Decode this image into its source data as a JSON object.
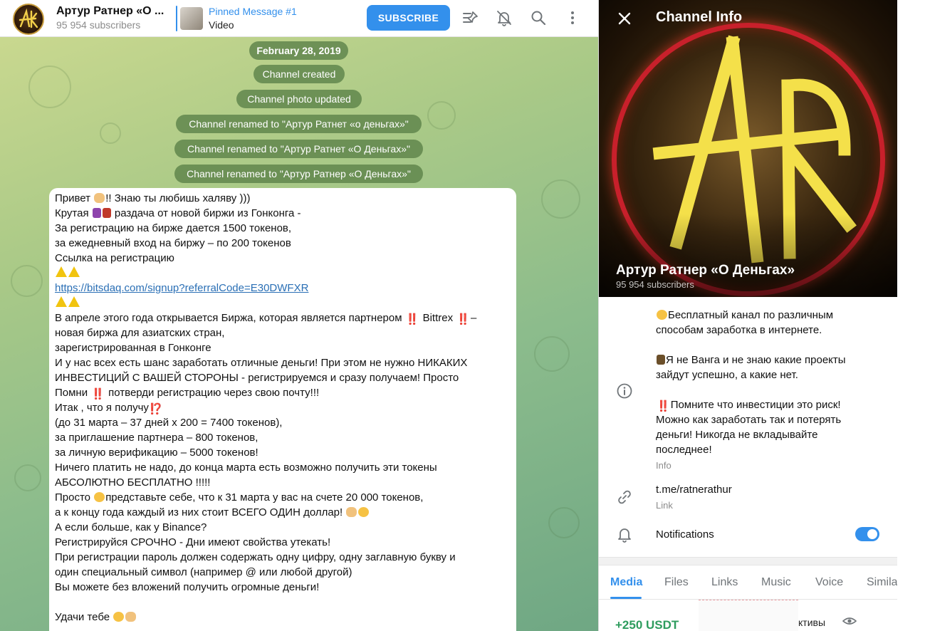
{
  "chat": {
    "title": "Артур Ратнер «О ...",
    "subscribers": "95 954 subscribers",
    "pinned_label": "Pinned Message #1",
    "pinned_text": "Video",
    "subscribe_label": "SUBSCRIBE",
    "icons": [
      "pinned-list-icon",
      "mute-bell-icon",
      "search-icon",
      "more-vertical-icon"
    ]
  },
  "service_messages": [
    "February 28, 2019",
    "Channel created",
    "Channel photo updated",
    "Channel renamed to \"Артур Ратнет «о деньгах»\"",
    "Channel renamed to \"Артур Ратнет «О Деньгах»\"",
    "Channel renamed to \"Артур Ратнер «О Деньгах»\""
  ],
  "message": {
    "l01": "Привет ",
    "l01b": "!! Знаю ты любишь халяву )))",
    "l02": "Крутая ",
    "l02b": " раздача от новой биржи из Гонконга -",
    "l03": "За регистрацию на бирже дается 1500 токенов,",
    "l04": "за ежедневный вход на биржу – по 200 токенов",
    "l05": "Ссылка на регистрацию",
    "link": "https://bitsdaq.com/signup?referralCode=E30DWFXR",
    "l08": "В апреле этого года открывается Биржа, которая является партнером ",
    "l08b": " Bittrex ",
    "l08c": "–",
    "l09": "новая биржа для азиатских стран,",
    "l10": "зарегистрированная в Гонконге",
    "l11": "И у нас всех есть шанс заработать отличные деньги! При этом не нужно НИКАКИХ",
    "l12": "ИНВЕСТИЦИЙ С ВАШЕЙ СТОРОНЫ - регистрируемся и сразу получаем! Просто",
    "l13": "Помни ",
    "l13b": " потверди регистрацию через свою почту!!!",
    "l14": "Итак , что я получу",
    "l15": "(до 31 марта – 37 дней х 200 = 7400 токенов),",
    "l16": "за приглашение партнера – 800 токенов,",
    "l17": "за личную верификацию – 5000 токенов!",
    "l18": "Ничего платить не надо, до конца марта есть возможно получить эти токены",
    "l19": "АБСОЛЮТНО БЕСПЛАТНО !!!!!",
    "l20": "Просто ",
    "l20b": "представьте себе, что к 31 марта у вас на счете 20 000 токенов,",
    "l21": "а к концу года каждый из них стоит ВСЕГО ОДИН доллар! ",
    "l22": "А если больше, как у Binance?",
    "l23": "Регистрируйся СРОЧНО - Дни имеют свойства утекать!",
    "l24": "При регистрации пароль должен содержать одну цифру, одну заглавную букву и",
    "l25": "один специальный символ (например @ или любой другой)",
    "l26": "Вы можете без вложений получить огромные деньги!",
    "l28": "Удачи тебе ",
    "bang": "‼️",
    "interrobang": "⁉️"
  },
  "info": {
    "header": "Channel Info",
    "name": "Артур Ратнер «О Деньгах»",
    "subscribers": "95 954 subscribers",
    "desc1": "Бесплатный канал по различным",
    "desc2": "способам заработка в интернете.",
    "desc3": "Я не Ванга и не знаю какие проекты",
    "desc4": "зайдут успешно, а какие нет.",
    "desc5": "Помните что инвестиции это риск!",
    "desc6": "Можно как заработать так и потерять",
    "desc7": "деньги! Никогда не вкладывайте",
    "desc8": "последнее!",
    "desc_label": "Info",
    "link": "t.me/ratnerathur",
    "link_label": "Link",
    "notifications": "Notifications",
    "notifications_on": true,
    "tabs": [
      "Media",
      "Files",
      "Links",
      "Music",
      "Voice",
      "Simila"
    ],
    "media_caption": "+250 USDT",
    "media_text": "ктивы"
  },
  "colors": {
    "accent": "#3390ec",
    "service_bubble": "#60864c",
    "usdt_green": "#2e9c5e"
  }
}
